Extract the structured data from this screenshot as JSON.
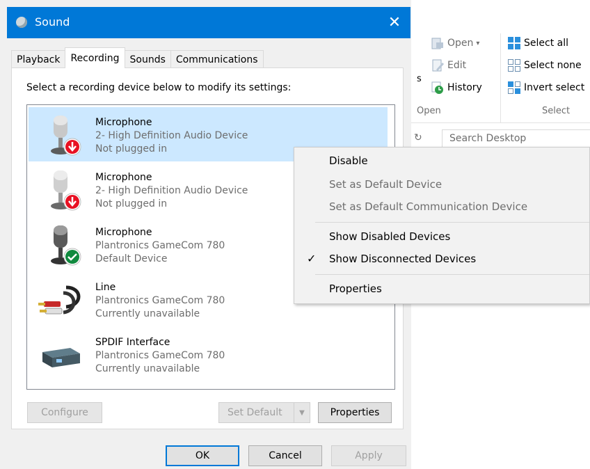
{
  "explorer": {
    "ribbon": {
      "open": {
        "label": "Open",
        "dropdown": "▾"
      },
      "edit": {
        "label": "Edit"
      },
      "history": {
        "label": "History"
      },
      "select_all": {
        "label": "Select all"
      },
      "select_none": {
        "label": "Select none"
      },
      "invert_selection": {
        "label": "Invert select"
      },
      "group_open": "Open",
      "group_select": "Select",
      "clipped_text": "s"
    },
    "search_placeholder": "Search Desktop"
  },
  "dialog": {
    "title": "Sound",
    "close_glyph": "✕",
    "tabs": [
      {
        "label": "Playback"
      },
      {
        "label": "Recording"
      },
      {
        "label": "Sounds"
      },
      {
        "label": "Communications"
      }
    ],
    "active_tab": "Recording",
    "instruction": "Select a recording device below to modify its settings:",
    "devices": [
      {
        "name": "Microphone",
        "detail": "2- High Definition Audio Device",
        "status": "Not plugged in",
        "icon": "microphone-icon",
        "badge": "unplugged-badge-icon",
        "selected": true
      },
      {
        "name": "Microphone",
        "detail": "2- High Definition Audio Device",
        "status": "Not plugged in",
        "icon": "microphone-icon",
        "badge": "unplugged-badge-icon",
        "selected": false
      },
      {
        "name": "Microphone",
        "detail": "Plantronics GameCom 780",
        "status": "Default Device",
        "icon": "microphone-icon",
        "badge": "default-check-badge-icon",
        "selected": false
      },
      {
        "name": "Line",
        "detail": "Plantronics GameCom 780",
        "status": "Currently unavailable",
        "icon": "rca-cable-icon",
        "selected": false
      },
      {
        "name": "SPDIF Interface",
        "detail": "Plantronics GameCom 780",
        "status": "Currently unavailable",
        "icon": "spdif-box-icon",
        "selected": false
      }
    ],
    "buttons": {
      "configure": "Configure",
      "set_default": "Set Default",
      "properties": "Properties",
      "ok": "OK",
      "cancel": "Cancel",
      "apply": "Apply"
    }
  },
  "context_menu": {
    "items": [
      {
        "label": "Disable",
        "enabled": true,
        "checked": false
      },
      {
        "label": "Set as Default Device",
        "enabled": false,
        "checked": false
      },
      {
        "label": "Set as Default Communication Device",
        "enabled": false,
        "checked": false
      },
      {
        "label": "Show Disabled Devices",
        "enabled": true,
        "checked": false
      },
      {
        "label": "Show Disconnected Devices",
        "enabled": true,
        "checked": true
      },
      {
        "label": "Properties",
        "enabled": true,
        "checked": false
      }
    ],
    "check_glyph": "✓"
  },
  "colors": {
    "titlebar": "#0078d7",
    "selection": "#cce8ff",
    "unplugged_badge": "#e81123",
    "default_badge": "#10893e",
    "checkmark": "#0078d7"
  }
}
